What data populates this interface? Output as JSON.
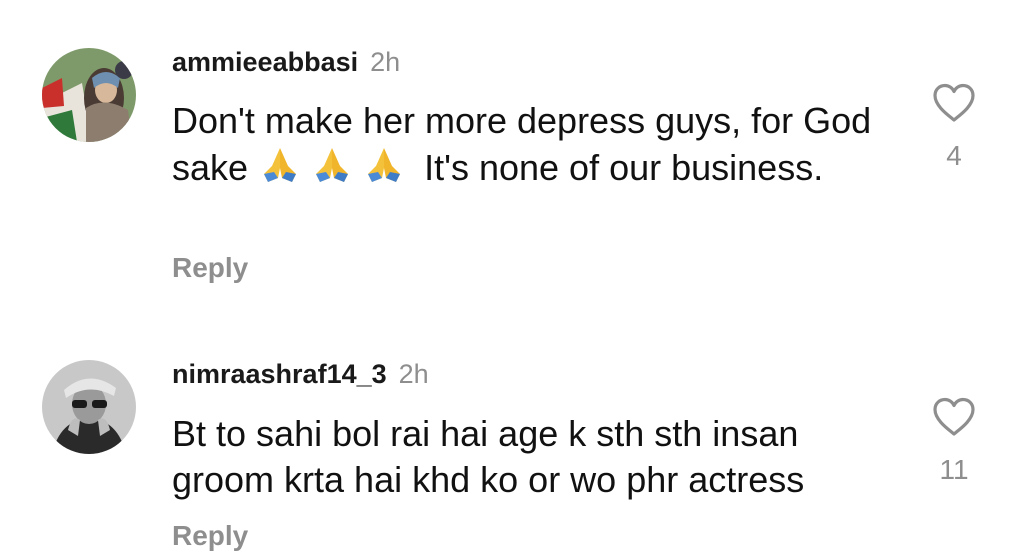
{
  "comments": [
    {
      "username": "ammieeabbasi",
      "time": "2h",
      "text_part1": "Don't make her more depress guys, for God sake",
      "emojis": [
        "🙏",
        "🙏",
        "🙏"
      ],
      "text_part2": "It's none of our business.",
      "reply_label": "Reply",
      "likes": "4",
      "avatar_icon": "profile-photo"
    },
    {
      "username": "nimraashraf14_3",
      "time": "2h",
      "text": "Bt to sahi bol rai hai age k sth sth insan groom krta hai khd ko or wo phr actress",
      "reply_label": "Reply",
      "likes": "11",
      "avatar_icon": "profile-photo"
    }
  ],
  "colors": {
    "text": "#111111",
    "muted": "#8e8e8e",
    "background": "#ffffff"
  }
}
